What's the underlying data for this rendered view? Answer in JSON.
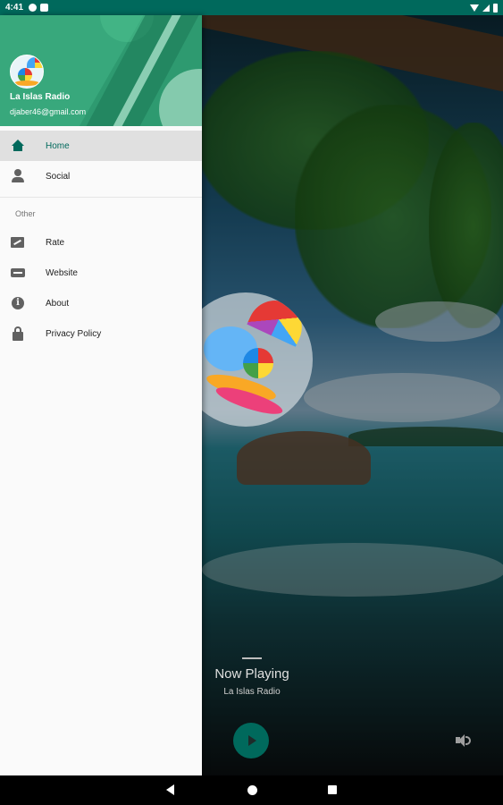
{
  "status_bar": {
    "time": "4:41",
    "icons": [
      "app-notification-icon",
      "sim-icon",
      "wifi-icon",
      "cell-signal-icon",
      "battery-icon"
    ]
  },
  "drawer": {
    "header": {
      "name": "La Islas Radio",
      "email": "djaber46@gmail.com"
    },
    "items": [
      {
        "label": "Home",
        "icon": "home-icon",
        "active": true
      },
      {
        "label": "Social",
        "icon": "person-icon",
        "active": false
      }
    ],
    "section_label": "Other",
    "other_items": [
      {
        "label": "Rate",
        "icon": "rate-review-icon"
      },
      {
        "label": "Website",
        "icon": "web-icon"
      },
      {
        "label": "About",
        "icon": "info-icon"
      },
      {
        "label": "Privacy Policy",
        "icon": "lock-icon"
      }
    ]
  },
  "player": {
    "now_playing_title": "Now Playing",
    "station": "La Islas Radio",
    "play_icon": "play-icon",
    "volume_icon": "volume-icon"
  },
  "nav_bar": {
    "icons": [
      "back-icon",
      "home-circle-icon",
      "recents-icon"
    ]
  },
  "colors": {
    "primary_dark": "#00695c",
    "header_green": "#2e9a70",
    "drawer_bg": "#fafafa",
    "active_item_bg": "#e0e0e0"
  }
}
